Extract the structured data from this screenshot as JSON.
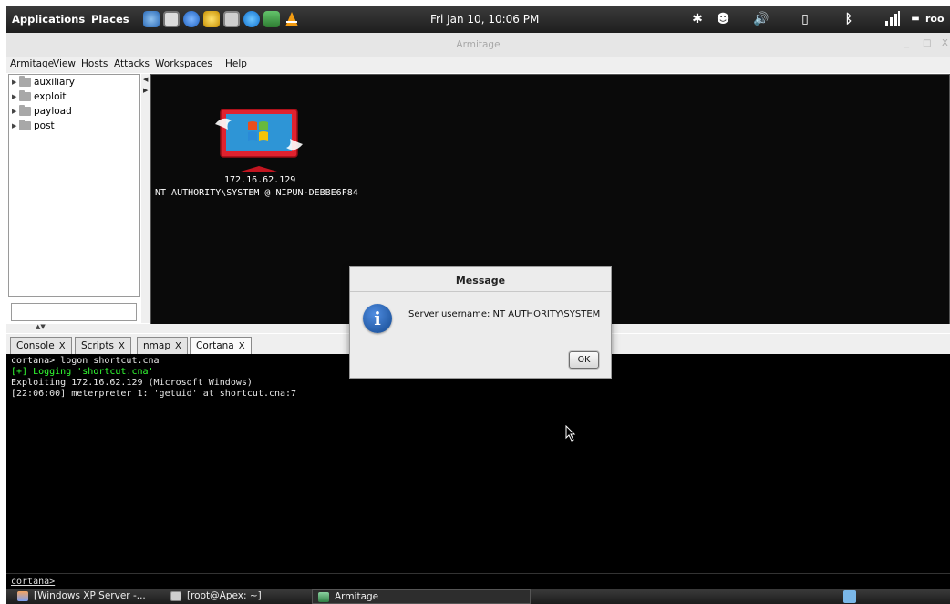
{
  "top_panel": {
    "applications": "Applications",
    "places": "Places",
    "clock": "Fri Jan 10, 10:06 PM",
    "user": "roo"
  },
  "window": {
    "title": "Armitage",
    "minimize": "_",
    "maximize": "□",
    "close": "X"
  },
  "menubar": {
    "items": [
      "Armitage",
      "View",
      "Hosts",
      "Attacks",
      "Workspaces",
      "Help"
    ]
  },
  "module_tree": {
    "items": [
      "auxiliary",
      "exploit",
      "payload",
      "post"
    ]
  },
  "host": {
    "ip": "172.16.62.129",
    "user": "NT AUTHORITY\\SYSTEM @ NIPUN-DEBBE6F84"
  },
  "tabs": [
    {
      "label": "Console",
      "close": "X"
    },
    {
      "label": "Scripts",
      "close": "X"
    },
    {
      "label": "nmap",
      "close": "X"
    },
    {
      "label": "Cortana",
      "close": "X"
    }
  ],
  "console": {
    "lines": [
      "cortana> logon shortcut.cna",
      "[+] Logging 'shortcut.cna'",
      "Exploiting 172.16.62.129 (Microsoft Windows)",
      "[22:06:00] meterpreter 1: 'getuid' at shortcut.cna:7"
    ],
    "prompt": "cortana>"
  },
  "dialog": {
    "title": "Message",
    "message": "Server username: NT AUTHORITY\\SYSTEM",
    "ok_label": "OK"
  },
  "taskbar": {
    "items": [
      "[Windows XP Server -...",
      "[root@Apex: ~]",
      "Armitage"
    ]
  }
}
